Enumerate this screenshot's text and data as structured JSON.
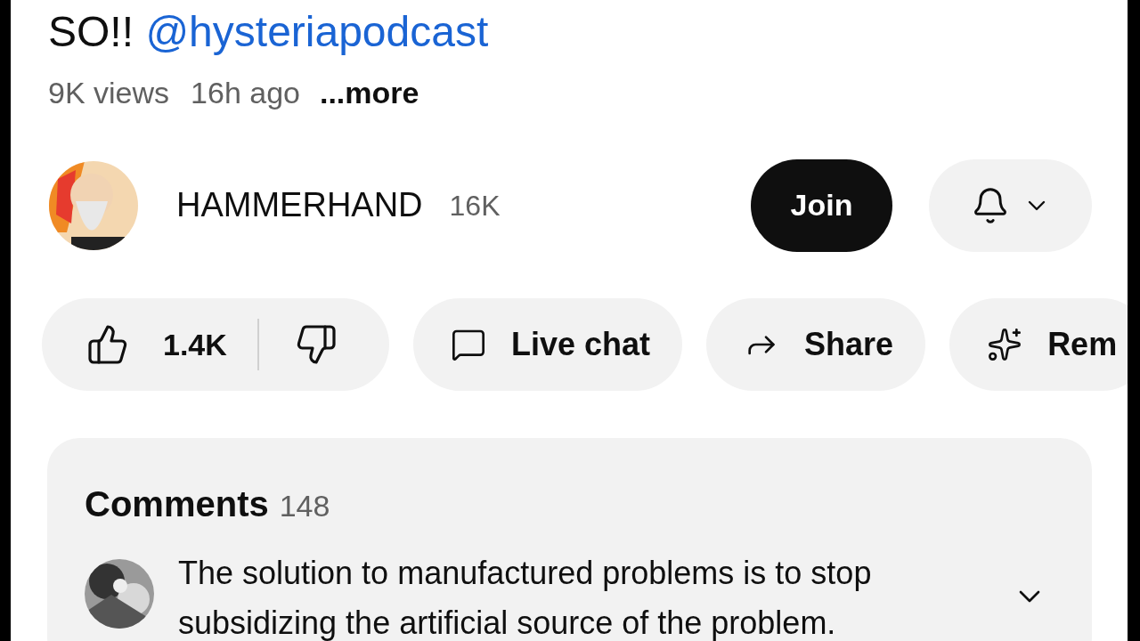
{
  "title": {
    "text": "SO!!",
    "mention": "@hysteriapodcast"
  },
  "stats": {
    "views": "9K views",
    "age": "16h ago",
    "more": "...more"
  },
  "channel": {
    "name": "HAMMERHAND",
    "subscribers": "16K",
    "join": "Join"
  },
  "actions": [
    {
      "kind": "like",
      "likes": "1.4K"
    },
    {
      "kind": "chat",
      "label": "Live chat"
    },
    {
      "kind": "share",
      "label": "Share"
    },
    {
      "kind": "remix",
      "label": "Rem"
    }
  ],
  "comments": {
    "title": "Comments",
    "count": "148",
    "top_comment": "The solution to manufactured problems is to stop subsidizing the artificial source of the problem.",
    "expanded": false
  }
}
